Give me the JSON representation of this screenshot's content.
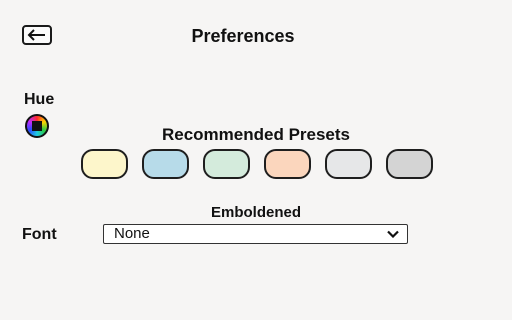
{
  "header": {
    "title": "Preferences",
    "back_icon": "arrow-left-icon"
  },
  "hue": {
    "label": "Hue",
    "icon": "color-wheel-icon"
  },
  "presets": {
    "title": "Recommended Presets",
    "colors": [
      "#fdf6cb",
      "#b7dbe9",
      "#d4ebdc",
      "#fbd6bd",
      "#e6e7e8",
      "#d4d4d4"
    ]
  },
  "font": {
    "style_label": "Emboldened",
    "label": "Font",
    "selected": "None",
    "dropdown_icon": "chevron-down-icon"
  }
}
